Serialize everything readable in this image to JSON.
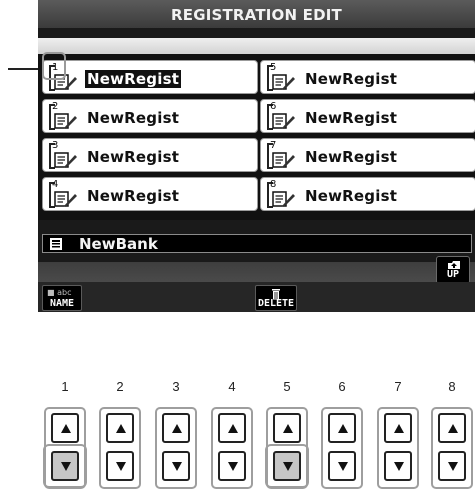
{
  "screen": {
    "title": "REGISTRATION EDIT",
    "registrations": [
      {
        "num": "1",
        "name": "NewRegist",
        "selected": true
      },
      {
        "num": "2",
        "name": "NewRegist",
        "selected": false
      },
      {
        "num": "3",
        "name": "NewRegist",
        "selected": false
      },
      {
        "num": "4",
        "name": "NewRegist",
        "selected": false
      },
      {
        "num": "5",
        "name": "NewRegist",
        "selected": false
      },
      {
        "num": "6",
        "name": "NewRegist",
        "selected": false
      },
      {
        "num": "7",
        "name": "NewRegist",
        "selected": false
      },
      {
        "num": "8",
        "name": "NewRegist",
        "selected": false
      }
    ],
    "bank_name": "NewBank",
    "up_label": "UP",
    "name_button": {
      "top_text": "abc",
      "label": "NAME"
    },
    "delete_button": {
      "label": "DELETE"
    }
  },
  "hardware_buttons": {
    "numbers": [
      "1",
      "2",
      "3",
      "4",
      "5",
      "6",
      "7",
      "8"
    ],
    "highlighted_down": [
      "1",
      "5"
    ]
  },
  "colors": {
    "screen_bg": "#1a1a1a",
    "title_bar": "#4a4a4a",
    "item_bg": "#ffffff",
    "selection_bg": "#111111",
    "pressed_button": "#c6c6c6",
    "highlight_outline": "#9e9e9e"
  },
  "icons": {
    "registration": "registration-edit-icon",
    "bank": "bank-file-icon",
    "up": "folder-up-icon",
    "delete": "trash-icon",
    "up_button": "triangle-up-icon",
    "down_button": "triangle-down-icon"
  }
}
